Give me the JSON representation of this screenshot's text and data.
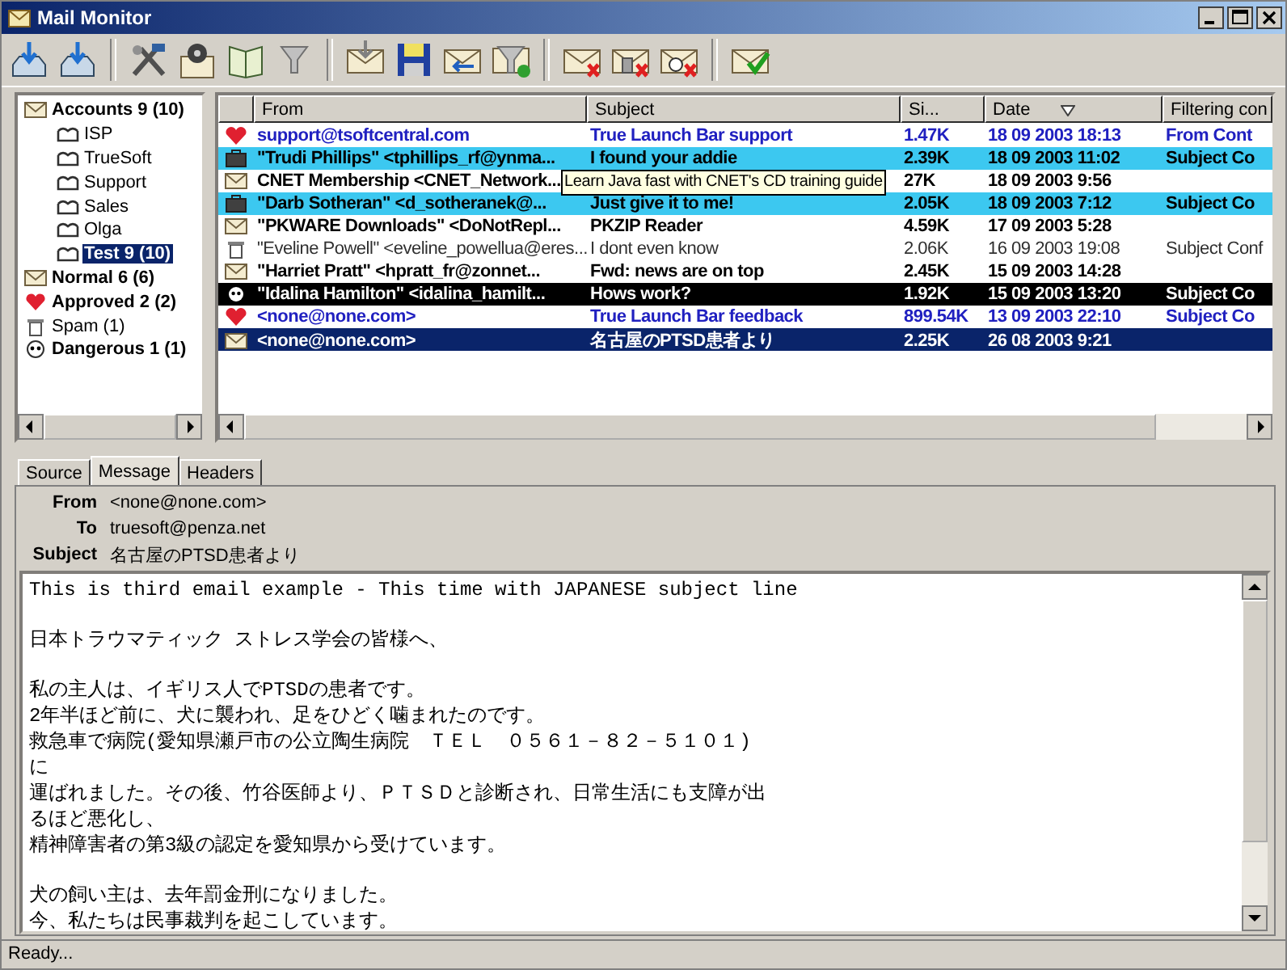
{
  "window": {
    "title": "Mail Monitor"
  },
  "tree": [
    {
      "label": "Accounts 9 (10)",
      "kind": "accounts",
      "unread": true,
      "selected": false,
      "children": [
        {
          "label": "ISP",
          "kind": "mailbox",
          "unread": false,
          "selected": false
        },
        {
          "label": "TrueSoft",
          "kind": "mailbox",
          "unread": false,
          "selected": false
        },
        {
          "label": "Support",
          "kind": "mailbox",
          "unread": false,
          "selected": false
        },
        {
          "label": "Sales",
          "kind": "mailbox",
          "unread": false,
          "selected": false
        },
        {
          "label": "Olga",
          "kind": "mailbox",
          "unread": false,
          "selected": false
        },
        {
          "label": "Test 9 (10)",
          "kind": "mailbox",
          "unread": true,
          "selected": true
        }
      ]
    },
    {
      "label": "Normal 6 (6)",
      "kind": "normal",
      "unread": true,
      "selected": false
    },
    {
      "label": "Approved 2 (2)",
      "kind": "approved",
      "unread": true,
      "selected": false
    },
    {
      "label": "Spam (1)",
      "kind": "spam",
      "unread": false,
      "selected": false
    },
    {
      "label": "Dangerous 1 (1)",
      "kind": "dangerous",
      "unread": true,
      "selected": false
    }
  ],
  "table": {
    "columns": [
      {
        "label": "From",
        "sorted": false
      },
      {
        "label": "Subject",
        "sorted": false
      },
      {
        "label": "Si...",
        "sorted": false
      },
      {
        "label": "Date",
        "sorted": true
      },
      {
        "label": "Filtering con",
        "sorted": false
      }
    ],
    "rows": [
      {
        "kind": "approved",
        "unread": true,
        "selected": false,
        "from": "support@tsoftcentral.com",
        "subject": "True Launch Bar support",
        "size": "1.47K",
        "date": "18 09 2003 18:13",
        "filter": "From Cont"
      },
      {
        "kind": "suspicious",
        "unread": true,
        "selected": false,
        "from": "\"Trudi Phillips\" <tphillips_rf@ynma...",
        "subject": "I found your addie",
        "size": "2.39K",
        "date": "18 09 2003 11:02",
        "filter": "Subject Co"
      },
      {
        "kind": "normal",
        "unread": true,
        "selected": false,
        "from": "CNET Membership <CNET_Network...",
        "size": "27K",
        "date": "18 09 2003 9:56"
      },
      {
        "kind": "suspicious",
        "unread": true,
        "selected": false,
        "from": "\"Darb Sotheran\" <d_sotheranek@...",
        "subject": "Just give it to me!",
        "size": "2.05K",
        "date": "18 09 2003 7:12",
        "filter": "Subject Co"
      },
      {
        "kind": "normal",
        "unread": true,
        "selected": false,
        "from": "\"PKWARE Downloads\" <DoNotRepl...",
        "subject": "PKZIP Reader",
        "size": "4.59K",
        "date": "17 09 2003 5:28"
      },
      {
        "kind": "spam",
        "unread": false,
        "selected": false,
        "from": "\"Eveline Powell\" <eveline_powellua@eres...",
        "subject": "I dont even know",
        "size": "2.06K",
        "date": "16 09 2003 19:08",
        "filter": "Subject Conf"
      },
      {
        "kind": "normal",
        "unread": true,
        "selected": false,
        "from": "\"Harriet Pratt\" <hpratt_fr@zonnet...",
        "subject": "Fwd: news are on top",
        "size": "2.45K",
        "date": "15 09 2003 14:28"
      },
      {
        "kind": "dangerous",
        "unread": true,
        "selected": false,
        "from": "\"Idalina Hamilton\" <idalina_hamilt...",
        "subject": "Hows work?",
        "size": "1.92K",
        "date": "15 09 2003 13:20",
        "filter": "Subject Co"
      },
      {
        "kind": "approved",
        "unread": true,
        "selected": false,
        "from": "<none@none.com>",
        "subject": "True Launch Bar feedback",
        "size": "899.54K",
        "date": "13 09 2003 22:10",
        "filter": "Subject Co"
      },
      {
        "kind": "normal",
        "unread": true,
        "selected": true,
        "from": "<none@none.com>",
        "subject": "名古屋のPTSD患者より",
        "size": "2.25K",
        "date": "26 08 2003 9:21"
      }
    ],
    "tooltip": "Learn Java fast with CNET's CD training guide"
  },
  "tabs": [
    {
      "label": "Source",
      "selected": false
    },
    {
      "label": "Message",
      "selected": true
    },
    {
      "label": "Headers",
      "selected": false
    }
  ],
  "headers": [
    {
      "label": "From",
      "value": "<none@none.com>"
    },
    {
      "label": "To",
      "value": "truesoft@penza.net"
    },
    {
      "label": "Subject",
      "value": "名古屋のPTSD患者より"
    }
  ],
  "body": [
    [
      "This is third email example - This time with JAPANESE subject line"
    ],
    [
      "日本トラウマティック ストレス学会の皆様へ、"
    ],
    [
      "私の主人は、イギリス人でPTSDの患者です。",
      "2年半ほど前に、犬に襲われ、足をひどく噛まれたのです。",
      "救急車で病院(愛知県瀬戸市の公立陶生病院　ＴＥＬ　０５６１－８２－５１０１)",
      "に",
      "運ばれました。その後、竹谷医師より、ＰＴＳＤと診断され、日常生活にも支障が出",
      "るほど悪化し、",
      "精神障害者の第3級の認定を愛知県から受けています。"
    ],
    [
      "犬の飼い主は、去年罰金刑になりました。",
      "今、私たちは民事裁判を起こしています。"
    ]
  ],
  "status_bar": "Ready..."
}
